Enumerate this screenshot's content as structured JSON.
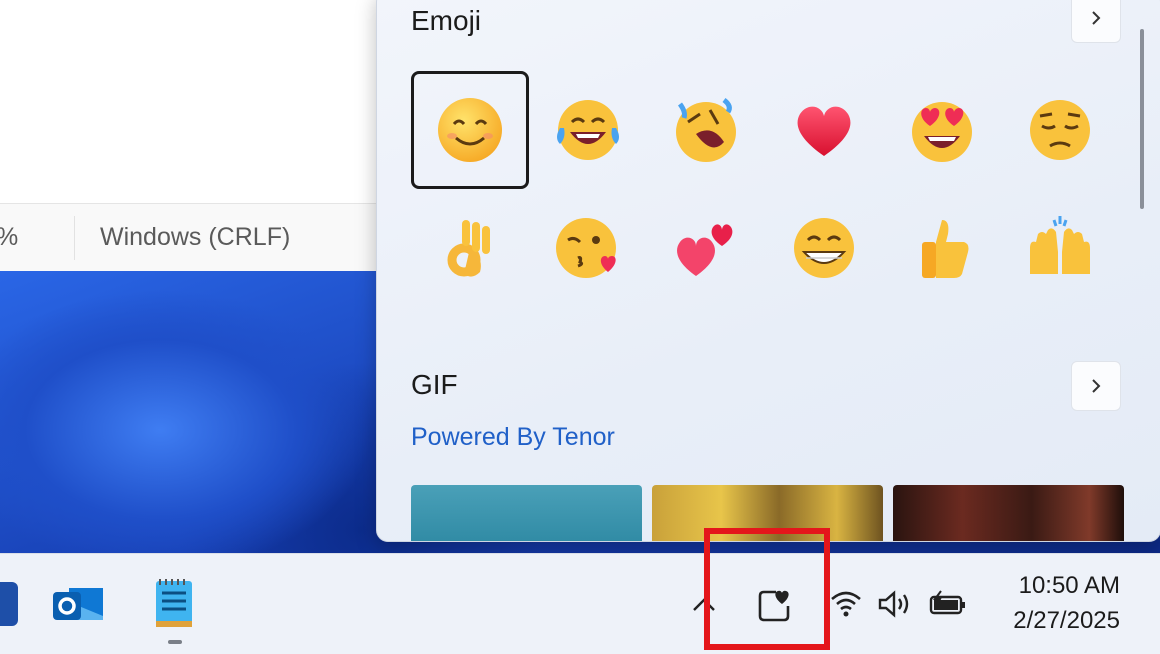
{
  "notepad": {
    "zoom_text": "%",
    "line_ending": "Windows (CRLF)"
  },
  "emoji_panel": {
    "emoji_section_title": "Emoji",
    "gif_section_title": "GIF",
    "gif_attribution": "Powered By Tenor",
    "emojis": [
      {
        "name": "smiling-face-icon",
        "selected": true
      },
      {
        "name": "face-with-tears-of-joy-icon",
        "selected": false
      },
      {
        "name": "rolling-on-floor-laughing-icon",
        "selected": false
      },
      {
        "name": "red-heart-icon",
        "selected": false
      },
      {
        "name": "heart-eyes-icon",
        "selected": false
      },
      {
        "name": "pensive-face-icon",
        "selected": false
      },
      {
        "name": "ok-hand-icon",
        "selected": false
      },
      {
        "name": "face-blowing-kiss-icon",
        "selected": false
      },
      {
        "name": "two-hearts-icon",
        "selected": false
      },
      {
        "name": "grinning-face-icon",
        "selected": false
      },
      {
        "name": "thumbs-up-icon",
        "selected": false
      },
      {
        "name": "raising-hands-icon",
        "selected": false
      }
    ]
  },
  "taskbar": {
    "apps": [
      "outlook-icon",
      "notepad-icon"
    ],
    "tray_icons": [
      "show-hidden-icons-chevron",
      "emoji-panel-tray-icon",
      "wifi-icon",
      "volume-icon",
      "battery-icon"
    ],
    "clock": {
      "time": "10:50 AM",
      "date": "2/27/2025"
    }
  },
  "colors": {
    "highlight": "#e4161b",
    "link": "#2060c8",
    "accent": "#1f4fc9"
  }
}
